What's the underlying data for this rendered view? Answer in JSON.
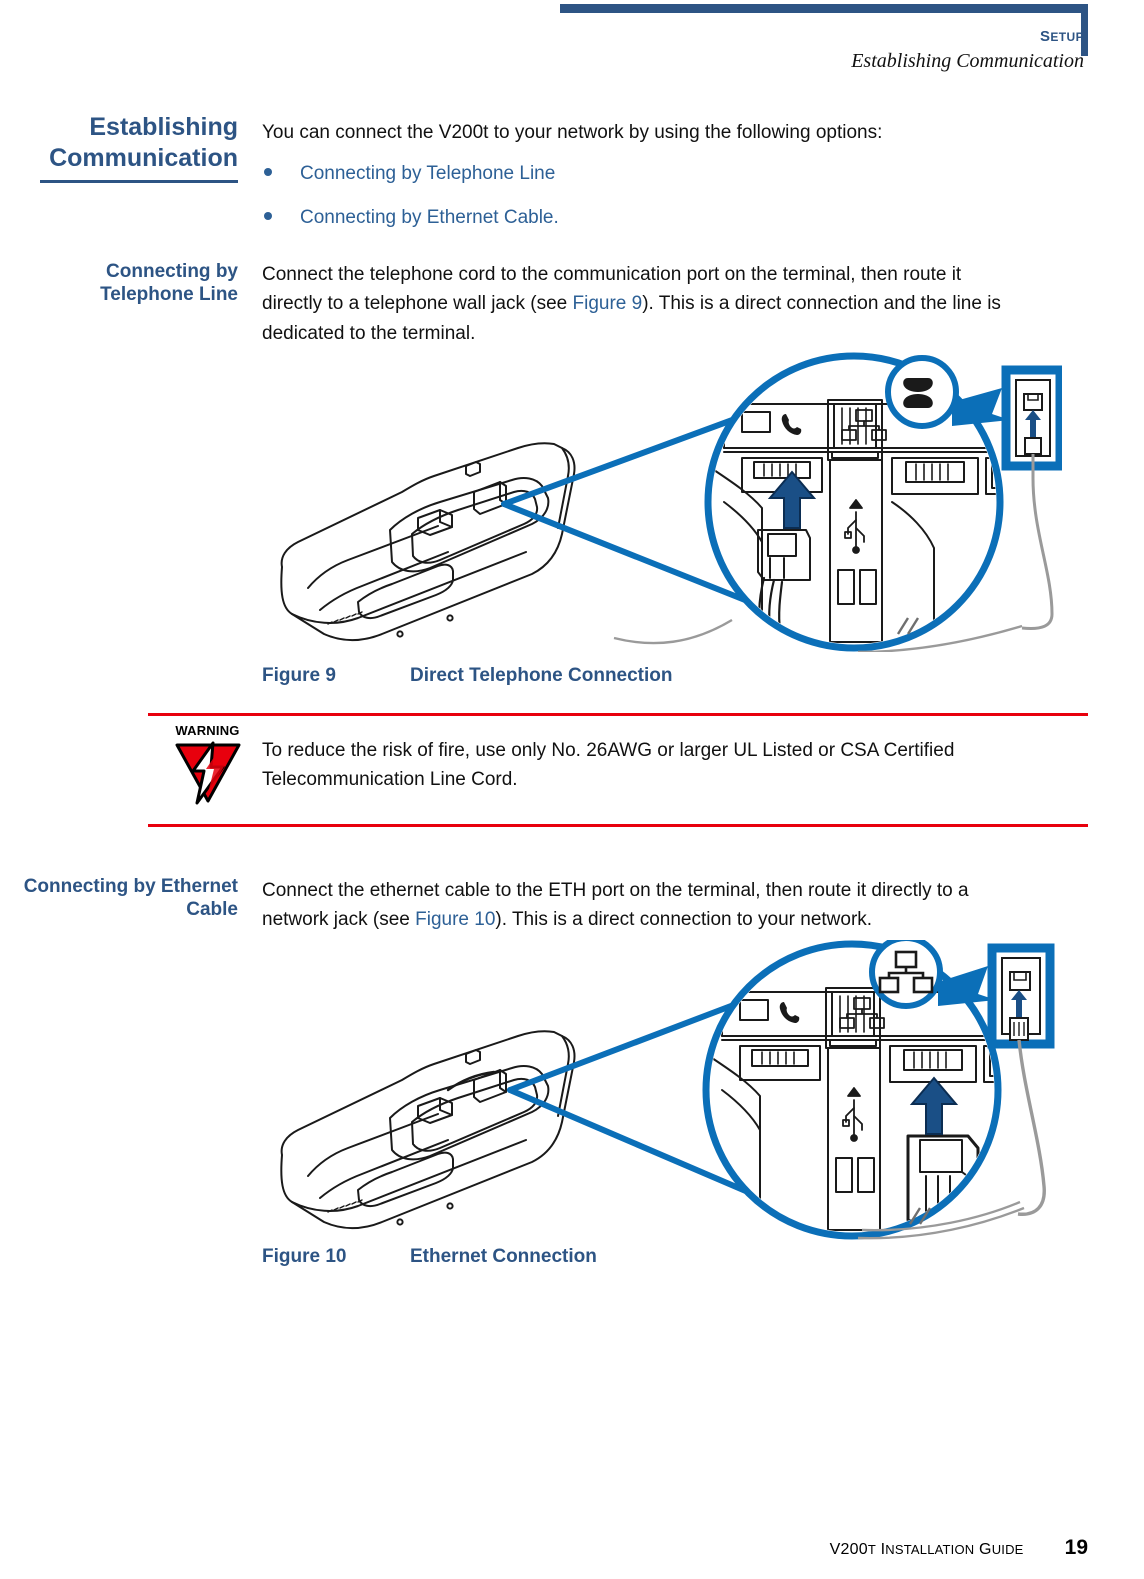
{
  "header": {
    "chapter": "SETUP",
    "chapter_lead": "S",
    "chapter_rest": "ETUP",
    "section": "Establishing Communication"
  },
  "rail": {
    "main_heading": "Establishing Communication",
    "sub_heading_1": "Connecting by Telephone Line",
    "sub_heading_2": "Connecting by Ethernet Cable"
  },
  "intro": {
    "text": "You can connect the V200t to your network by using the following options:",
    "options": [
      "Connecting by Telephone Line",
      "Connecting by Ethernet Cable."
    ]
  },
  "section_telephone": {
    "body_before_link": "Connect the telephone cord to the communication port on the terminal, then route it directly to a telephone wall jack (see ",
    "link": "Figure 9",
    "body_after_link": "). This is a direct connection and the line is dedicated to the terminal."
  },
  "section_ethernet": {
    "body_before_link": "Connect the ethernet cable to the ETH port on the terminal, then route it directly to a network jack (see ",
    "link": "Figure 10",
    "body_after_link": "). This is a direct connection to your network."
  },
  "figures": [
    {
      "number": "Figure 9",
      "title": "Direct Telephone Connection",
      "badge_icon": "telephone-handset-icon",
      "port_icons": [
        "phone-port-icon",
        "usb-icon",
        "ethernet-port-icon"
      ]
    },
    {
      "number": "Figure 10",
      "title": "Ethernet Connection",
      "badge_icon": "network-lan-icon",
      "port_icons": [
        "phone-port-icon",
        "usb-icon",
        "ethernet-port-icon"
      ]
    }
  ],
  "warning": {
    "label": "WARNING",
    "icon": "warning-lightning-triangle-icon",
    "text": "To reduce the risk of fire, use only No. 26AWG or larger UL Listed or CSA Certified Telecommunication Line Cord."
  },
  "footer": {
    "guide_lead": "V200",
    "guide_small_t": "T",
    "guide_rest_lead": " I",
    "guide_rest": "NSTALLATION",
    "guide_g": " G",
    "guide_guide": "UIDE",
    "guide_full": "V200t Installation Guide",
    "page_number": "19"
  },
  "colors": {
    "brand_blue": "#2d5484",
    "link_blue": "#2d6096",
    "figure_blue": "#0b6fb8",
    "arrow_navy": "#1a4f86",
    "warning_red": "#e8000d"
  }
}
